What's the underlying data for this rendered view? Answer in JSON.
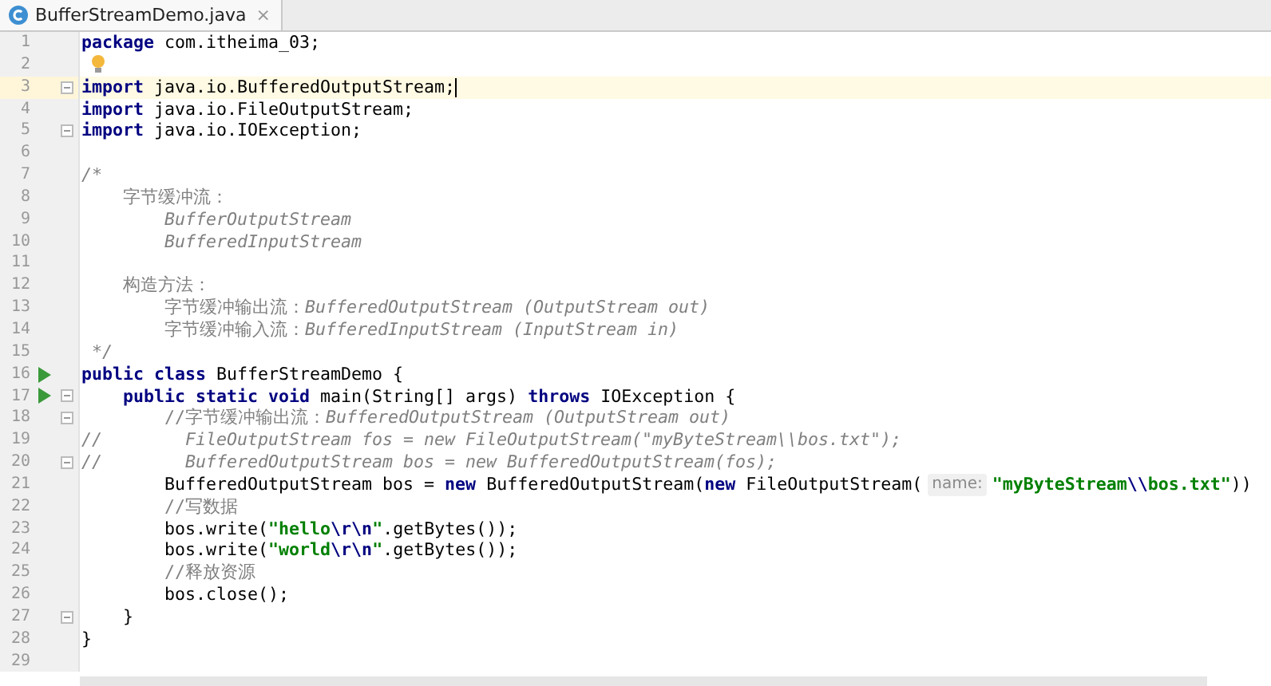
{
  "tabs": [
    {
      "title": "BufferStreamDemo.java",
      "close": "×",
      "selected": true
    }
  ],
  "lines": [
    {
      "number": "1",
      "current": false,
      "run": false,
      "fold": false,
      "bulb": false,
      "tokens": [
        {
          "kind": "keyword",
          "text": "package"
        },
        {
          "kind": "plain",
          "text": " com.itheima_03;"
        }
      ]
    },
    {
      "number": "2",
      "current": false,
      "run": false,
      "fold": false,
      "bulb": true
    },
    {
      "number": "3",
      "current": true,
      "run": false,
      "fold": true,
      "bulb": false,
      "tokens": [
        {
          "kind": "keyword",
          "text": "import"
        },
        {
          "kind": "plain",
          "text": " java.io.BufferedOutputStream;"
        }
      ]
    },
    {
      "number": "4",
      "current": false,
      "run": false,
      "fold": false,
      "bulb": false,
      "tokens": [
        {
          "kind": "keyword",
          "text": "import"
        },
        {
          "kind": "plain",
          "text": " java.io.FileOutputStream;"
        }
      ]
    },
    {
      "number": "5",
      "current": false,
      "run": false,
      "fold": true,
      "bulb": false,
      "tokens": [
        {
          "kind": "keyword",
          "text": "import"
        },
        {
          "kind": "plain",
          "text": " java.io.IOException;"
        }
      ]
    },
    {
      "number": "6",
      "current": false,
      "run": false,
      "fold": false,
      "bulb": false
    },
    {
      "number": "7",
      "current": false,
      "run": false,
      "fold": false,
      "bulb": false,
      "tokens": [
        {
          "kind": "comment",
          "text": "/*"
        }
      ]
    },
    {
      "number": "8",
      "current": false,
      "run": false,
      "fold": false,
      "bulb": false,
      "tokens": [
        {
          "kind": "comment-cjk",
          "text": "    字节缓冲流："
        }
      ]
    },
    {
      "number": "9",
      "current": false,
      "run": false,
      "fold": false,
      "bulb": false,
      "tokens": [
        {
          "kind": "comment",
          "text": "        BufferOutputStream"
        }
      ]
    },
    {
      "number": "10",
      "current": false,
      "run": false,
      "fold": false,
      "bulb": false,
      "tokens": [
        {
          "kind": "comment",
          "text": "        BufferedInputStream"
        }
      ]
    },
    {
      "number": "11",
      "current": false,
      "run": false,
      "fold": false,
      "bulb": false
    },
    {
      "number": "12",
      "current": false,
      "run": false,
      "fold": false,
      "bulb": false,
      "tokens": [
        {
          "kind": "comment-cjk",
          "text": "    构造方法："
        }
      ]
    },
    {
      "number": "13",
      "current": false,
      "run": false,
      "fold": false,
      "bulb": false,
      "tokens": [
        {
          "kind": "comment-cjk",
          "text": "        字节缓冲输出流："
        },
        {
          "kind": "comment",
          "text": "BufferedOutputStream (OutputStream out)"
        }
      ]
    },
    {
      "number": "14",
      "current": false,
      "run": false,
      "fold": false,
      "bulb": false,
      "tokens": [
        {
          "kind": "comment-cjk",
          "text": "        字节缓冲输入流："
        },
        {
          "kind": "comment",
          "text": "BufferedInputStream (InputStream in)"
        }
      ]
    },
    {
      "number": "15",
      "current": false,
      "run": false,
      "fold": false,
      "bulb": false,
      "tokens": [
        {
          "kind": "comment",
          "text": " */"
        }
      ]
    },
    {
      "number": "16",
      "current": false,
      "run": true,
      "fold": false,
      "bulb": false,
      "tokens": [
        {
          "kind": "keyword",
          "text": "public class"
        },
        {
          "kind": "plain",
          "text": " BufferStreamDemo {"
        }
      ]
    },
    {
      "number": "17",
      "current": false,
      "run": true,
      "fold": true,
      "bulb": false,
      "tokens": [
        {
          "kind": "keyword",
          "text": "    public static void"
        },
        {
          "kind": "plain",
          "text": " main(String[] args) "
        },
        {
          "kind": "keyword",
          "text": "throws"
        },
        {
          "kind": "plain",
          "text": " IOException {"
        }
      ]
    },
    {
      "number": "18",
      "current": false,
      "run": false,
      "fold": true,
      "bulb": false,
      "tokens": [
        {
          "kind": "comment-cjk",
          "text": "        //字节缓冲输出流："
        },
        {
          "kind": "comment",
          "text": "BufferedOutputStream (OutputStream out)"
        }
      ]
    },
    {
      "number": "19",
      "current": false,
      "run": false,
      "fold": false,
      "bulb": false,
      "tokens": [
        {
          "kind": "comment",
          "text": "//        FileOutputStream fos = new FileOutputStream(\"myByteStream\\\\bos.txt\");"
        }
      ]
    },
    {
      "number": "20",
      "current": false,
      "run": false,
      "fold": true,
      "bulb": false,
      "tokens": [
        {
          "kind": "comment",
          "text": "//        BufferedOutputStream bos = new BufferedOutputStream(fos);"
        }
      ]
    },
    {
      "number": "21",
      "current": false,
      "run": false,
      "fold": false,
      "bulb": false,
      "tokens": [
        {
          "kind": "plain",
          "text": "        BufferedOutputStream bos = "
        },
        {
          "kind": "keyword",
          "text": "new"
        },
        {
          "kind": "plain",
          "text": " BufferedOutputStream("
        },
        {
          "kind": "keyword",
          "text": "new"
        },
        {
          "kind": "plain",
          "text": " FileOutputStream("
        },
        {
          "kind": "hint",
          "text": "name:"
        },
        {
          "kind": "string",
          "text": "\"myByteStream"
        },
        {
          "kind": "escape",
          "text": "\\\\"
        },
        {
          "kind": "string",
          "text": "bos.txt\""
        },
        {
          "kind": "plain",
          "text": "))"
        }
      ]
    },
    {
      "number": "22",
      "current": false,
      "run": false,
      "fold": false,
      "bulb": false,
      "tokens": [
        {
          "kind": "comment-cjk",
          "text": "        //写数据"
        }
      ]
    },
    {
      "number": "23",
      "current": false,
      "run": false,
      "fold": false,
      "bulb": false,
      "tokens": [
        {
          "kind": "plain",
          "text": "        bos.write("
        },
        {
          "kind": "string",
          "text": "\"hello"
        },
        {
          "kind": "escape",
          "text": "\\r\\n"
        },
        {
          "kind": "string",
          "text": "\""
        },
        {
          "kind": "plain",
          "text": ".getBytes());"
        }
      ]
    },
    {
      "number": "24",
      "current": false,
      "run": false,
      "fold": false,
      "bulb": false,
      "tokens": [
        {
          "kind": "plain",
          "text": "        bos.write("
        },
        {
          "kind": "string",
          "text": "\"world"
        },
        {
          "kind": "escape",
          "text": "\\r\\n"
        },
        {
          "kind": "string",
          "text": "\""
        },
        {
          "kind": "plain",
          "text": ".getBytes());"
        }
      ]
    },
    {
      "number": "25",
      "current": false,
      "run": false,
      "fold": false,
      "bulb": false,
      "tokens": [
        {
          "kind": "comment-cjk",
          "text": "        //释放资源"
        }
      ]
    },
    {
      "number": "26",
      "current": false,
      "run": false,
      "fold": false,
      "bulb": false,
      "tokens": [
        {
          "kind": "plain",
          "text": "        bos.close();"
        }
      ]
    },
    {
      "number": "27",
      "current": false,
      "run": false,
      "fold": true,
      "bulb": false,
      "tokens": [
        {
          "kind": "plain",
          "text": "    }"
        }
      ]
    },
    {
      "number": "28",
      "current": false,
      "run": false,
      "fold": false,
      "bulb": false,
      "tokens": [
        {
          "kind": "plain",
          "text": "}"
        }
      ]
    },
    {
      "number": "29",
      "current": false,
      "run": false,
      "fold": false,
      "bulb": false
    }
  ]
}
